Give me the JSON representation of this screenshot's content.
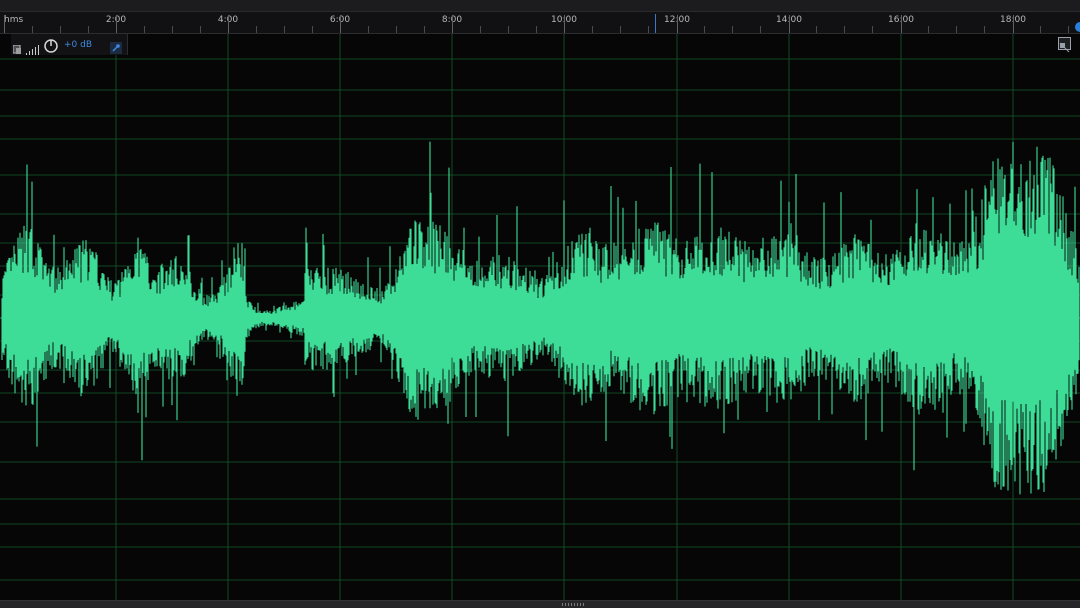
{
  "ruler": {
    "unit_label": "hms",
    "tick_labels": [
      "2:00",
      "4:00",
      "6:00",
      "8:00",
      "10:00",
      "12:00",
      "14:00",
      "16:00",
      "18:00"
    ]
  },
  "hud": {
    "gain_text": "+0 dB",
    "icons": [
      "track-indicator-icon",
      "signal-bars-icon",
      "power-dial-icon",
      "pin-icon"
    ]
  },
  "colors": {
    "waveform": "#3ddc97",
    "grid": "#155c2a",
    "background": "#060607",
    "accent": "#3a78c8"
  }
}
